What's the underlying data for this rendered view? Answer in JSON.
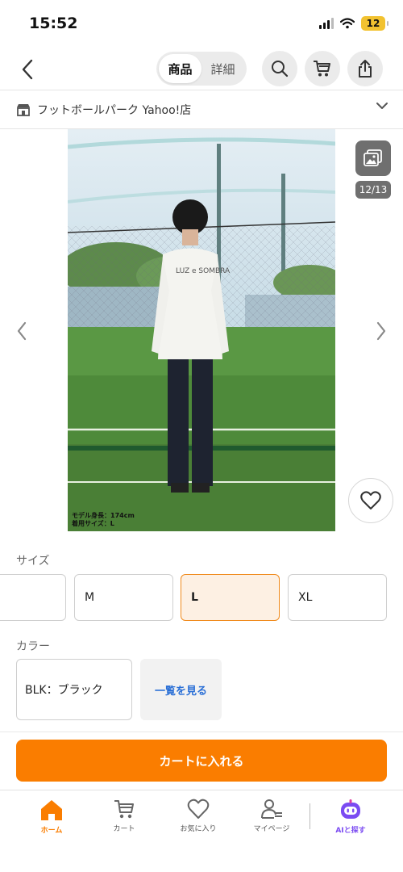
{
  "status": {
    "time": "15:52",
    "battery": "12"
  },
  "header": {
    "tab_product": "商品",
    "tab_detail": "詳細"
  },
  "store": {
    "name": "フットボールパーク Yahoo!店"
  },
  "gallery": {
    "counter": "12/13",
    "shirt_text": "LUZ e SOMBRA",
    "caption_line1": "モデル身長：174cm",
    "caption_line2": "着用サイズ：L"
  },
  "size": {
    "label": "サイズ",
    "options": [
      "",
      "M",
      "L",
      "XL"
    ],
    "selected": "L"
  },
  "color": {
    "label": "カラー",
    "selected": "BLK：ブラック",
    "see_all": "一覧を見る"
  },
  "cart_button": "カートに入れる",
  "tabbar": {
    "home": "ホーム",
    "cart": "カート",
    "favorites": "お気に入り",
    "mypage": "マイページ",
    "ai": "AIと探す"
  },
  "colors": {
    "accent": "#FA7D00",
    "link": "#2A6FD6",
    "ai_purple": "#7B4BF2"
  }
}
